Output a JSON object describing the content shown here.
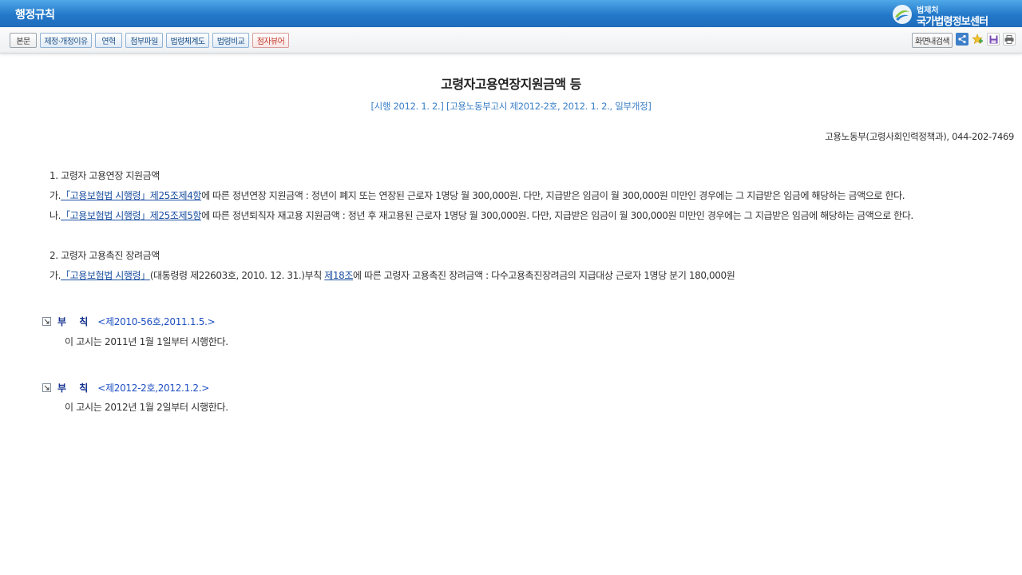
{
  "header": {
    "section_title": "행정규칙",
    "logo_top": "법제처",
    "logo_main": "국가법령정보센터"
  },
  "toolbar": {
    "buttons": [
      {
        "label": "본문"
      },
      {
        "label": "제정·개정이유"
      },
      {
        "label": "연혁"
      },
      {
        "label": "첨부파일"
      },
      {
        "label": "법령체계도"
      },
      {
        "label": "법령비교"
      },
      {
        "label": "점자뷰어"
      }
    ],
    "search_label": "화면내검색",
    "icons": [
      "share-icon",
      "bookmark-add-icon",
      "save-icon",
      "print-icon"
    ]
  },
  "document": {
    "title": "고령자고용연장지원금액 등",
    "subtitle": "[시행 2012. 1. 2.] [고용노동부고시 제2012-2호, 2012. 1. 2., 일부개정]",
    "department": "고용노동부(고령사회인력정책과), 044-202-7469",
    "sections": [
      {
        "heading": "1. 고령자 고용연장 지원금액",
        "items": [
          {
            "prefix": "가.",
            "link": "「고용보험법 시행령」제25조제4항",
            "text": "에 따른 정년연장 지원금액 : 정년이 폐지 또는 연장된 근로자 1명당 월 300,000원. 다만, 지급받은 임금이 월 300,000원 미만인 경우에는 그 지급받은 임금에 해당하는 금액으로 한다."
          },
          {
            "prefix": "나.",
            "link": "「고용보험법 시행령」제25조제5항",
            "text": "에 따른 정년퇴직자 재고용 지원금액 : 정년 후 재고용된 근로자 1명당 월 300,000원. 다만, 지급받은 임금이 월 300,000원 미만인 경우에는 그 지급받은 임금에 해당하는 금액으로 한다."
          }
        ]
      },
      {
        "heading": "2. 고령자 고용촉진 장려금액",
        "items": [
          {
            "prefix": "가.",
            "link": "「고용보험법 시행령」",
            "mid": "(대통령령 제22603호, 2010. 12. 31.)부칙 ",
            "link2": "제18조",
            "text": "에 따른 고령자 고용촉진 장려금액 : 다수고용촉진장려금의 지급대상 근로자 1명당 분기 180,000원"
          }
        ]
      }
    ],
    "addenda": [
      {
        "label": "부 칙",
        "ref": "<제2010-56호,2011.1.5.>",
        "text": "이 고시는 2011년 1월 1일부터 시행한다."
      },
      {
        "label": "부 칙",
        "ref": "<제2012-2호,2012.1.2.>",
        "text": "이 고시는 2012년 1월 2일부터 시행한다."
      }
    ]
  }
}
